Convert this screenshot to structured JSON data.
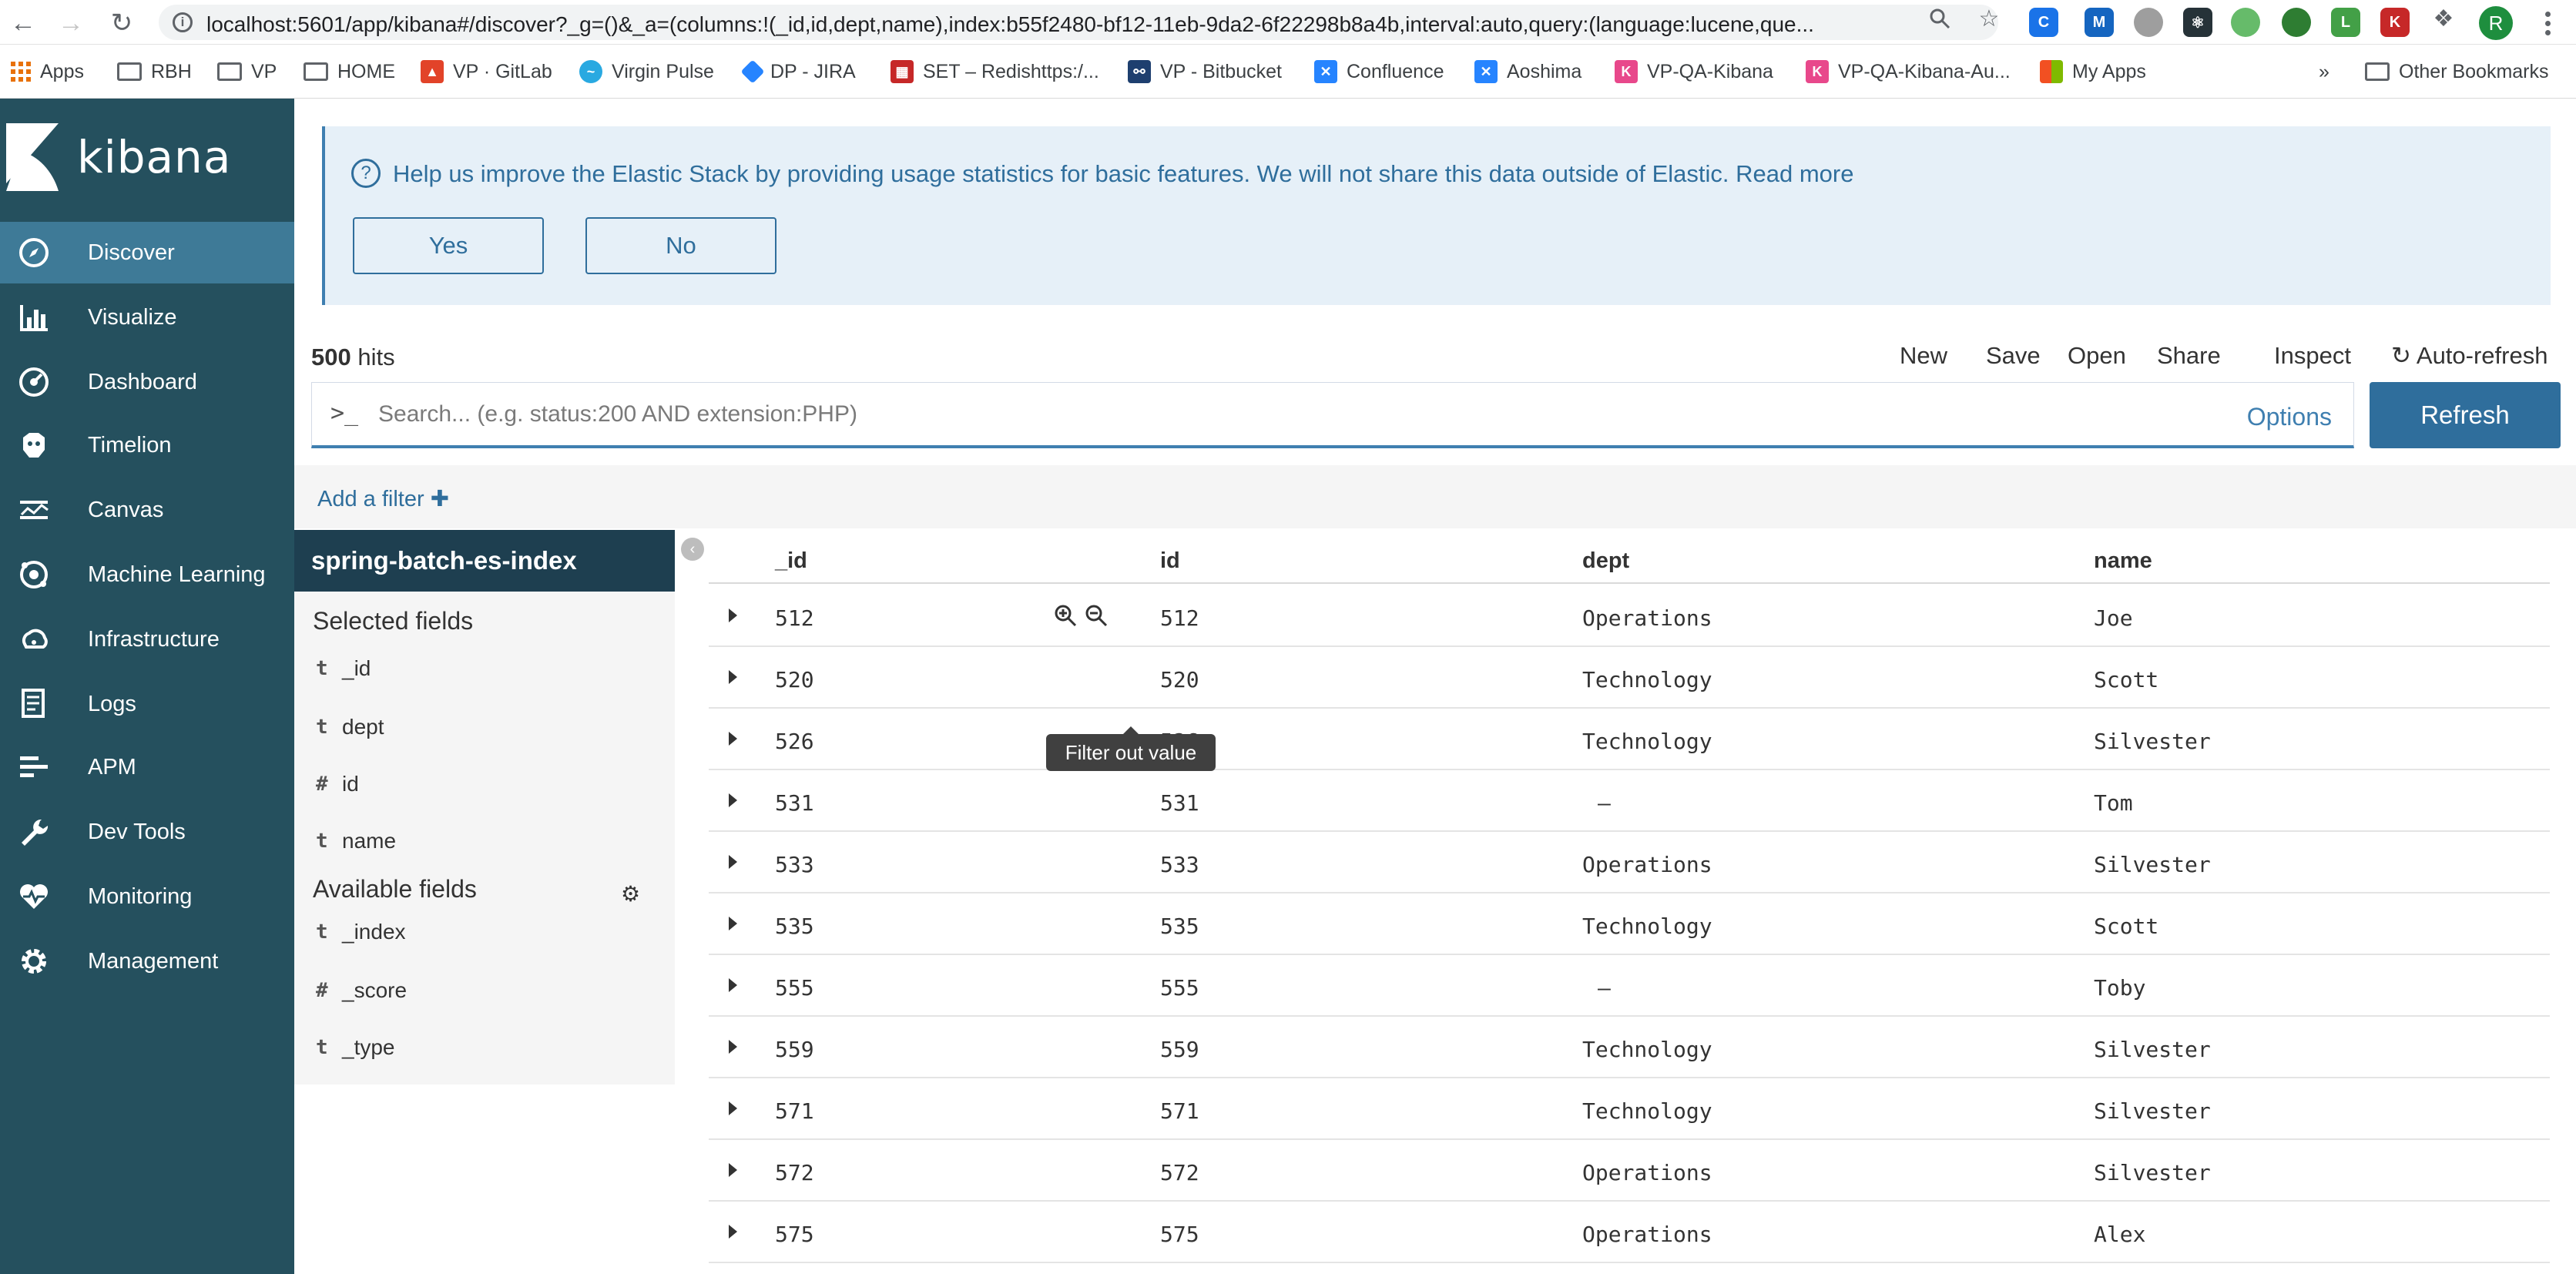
{
  "browser": {
    "url": "localhost:5601/app/kibana#/discover?_g=()&_a=(columns:!(_id,id,dept,name),index:b55f2480-bf12-11eb-9da2-6f22298b8a4b,interval:auto,query:(language:lucene,que...",
    "bookmarks": [
      {
        "label": "Apps",
        "icon": "apps-grid-icon"
      },
      {
        "label": "RBH",
        "icon": "folder-icon"
      },
      {
        "label": "VP",
        "icon": "folder-icon"
      },
      {
        "label": "HOME",
        "icon": "folder-icon"
      },
      {
        "label": "VP · GitLab",
        "icon": "gitlab-icon"
      },
      {
        "label": "Virgin Pulse",
        "icon": "virgin-pulse-icon"
      },
      {
        "label": "DP - JIRA",
        "icon": "jira-icon"
      },
      {
        "label": "SET – Redishttps:/...",
        "icon": "redis-icon"
      },
      {
        "label": "VP - Bitbucket",
        "icon": "bitbucket-icon"
      },
      {
        "label": "Confluence",
        "icon": "confluence-icon"
      },
      {
        "label": "Aoshima",
        "icon": "confluence-icon"
      },
      {
        "label": "VP-QA-Kibana",
        "icon": "kibana-icon"
      },
      {
        "label": "VP-QA-Kibana-Au...",
        "icon": "kibana-icon"
      },
      {
        "label": "My Apps",
        "icon": "microsoft-icon"
      }
    ],
    "overflow_label": "»",
    "other_bookmarks": "Other Bookmarks",
    "avatar_letter": "R"
  },
  "kibana": {
    "logo_text": "kibana",
    "nav": [
      {
        "label": "Discover",
        "icon": "compass-icon",
        "active": true
      },
      {
        "label": "Visualize",
        "icon": "bar-chart-icon"
      },
      {
        "label": "Dashboard",
        "icon": "dashboard-icon"
      },
      {
        "label": "Timelion",
        "icon": "timelion-icon"
      },
      {
        "label": "Canvas",
        "icon": "canvas-icon"
      },
      {
        "label": "Machine Learning",
        "icon": "machine-learning-icon"
      },
      {
        "label": "Infrastructure",
        "icon": "infrastructure-icon"
      },
      {
        "label": "Logs",
        "icon": "logs-icon"
      },
      {
        "label": "APM",
        "icon": "apm-icon"
      },
      {
        "label": "Dev Tools",
        "icon": "wrench-icon"
      },
      {
        "label": "Monitoring",
        "icon": "heartbeat-icon"
      },
      {
        "label": "Management",
        "icon": "gear-icon"
      }
    ]
  },
  "callout": {
    "text": "Help us improve the Elastic Stack by providing usage statistics for basic features. We will not share this data outside of Elastic. Read more",
    "yes": "Yes",
    "no": "No"
  },
  "topbar": {
    "hits_count": "500",
    "hits_label": " hits",
    "links": [
      "New",
      "Save",
      "Open",
      "Share",
      "Inspect",
      "Auto-refresh"
    ]
  },
  "search": {
    "prompt": ">_",
    "placeholder": "Search... (e.g. status:200 AND extension:PHP)",
    "options": "Options",
    "refresh": "Refresh"
  },
  "filter": {
    "add_label": "Add a filter",
    "plus": "✚"
  },
  "fields": {
    "index_name": "spring-batch-es-index",
    "selected_title": "Selected fields",
    "selected": [
      {
        "type": "t",
        "name": "_id"
      },
      {
        "type": "t",
        "name": "dept"
      },
      {
        "type": "#",
        "name": "id"
      },
      {
        "type": "t",
        "name": "name"
      }
    ],
    "available_title": "Available fields",
    "available": [
      {
        "type": "t",
        "name": "_index"
      },
      {
        "type": "#",
        "name": "_score"
      },
      {
        "type": "t",
        "name": "_type"
      }
    ]
  },
  "table": {
    "columns": [
      "_id",
      "id",
      "dept",
      "name"
    ],
    "rows": [
      [
        "512",
        "512",
        "Operations",
        "Joe"
      ],
      [
        "520",
        "520",
        "Technology",
        "Scott"
      ],
      [
        "526",
        "526",
        "Technology",
        "Silvester"
      ],
      [
        "531",
        "531",
        "–",
        "Tom"
      ],
      [
        "533",
        "533",
        "Operations",
        "Silvester"
      ],
      [
        "535",
        "535",
        "Technology",
        "Scott"
      ],
      [
        "555",
        "555",
        "–",
        "Toby"
      ],
      [
        "559",
        "559",
        "Technology",
        "Silvester"
      ],
      [
        "571",
        "571",
        "Technology",
        "Silvester"
      ],
      [
        "572",
        "572",
        "Operations",
        "Silvester"
      ],
      [
        "575",
        "575",
        "Operations",
        "Alex"
      ]
    ],
    "tooltip": "Filter out value"
  },
  "colors": {
    "sidebar": "#25505e",
    "active_nav": "#3e7a97",
    "accent": "#2f6e9c",
    "callout_bg": "#e6f0f8"
  }
}
